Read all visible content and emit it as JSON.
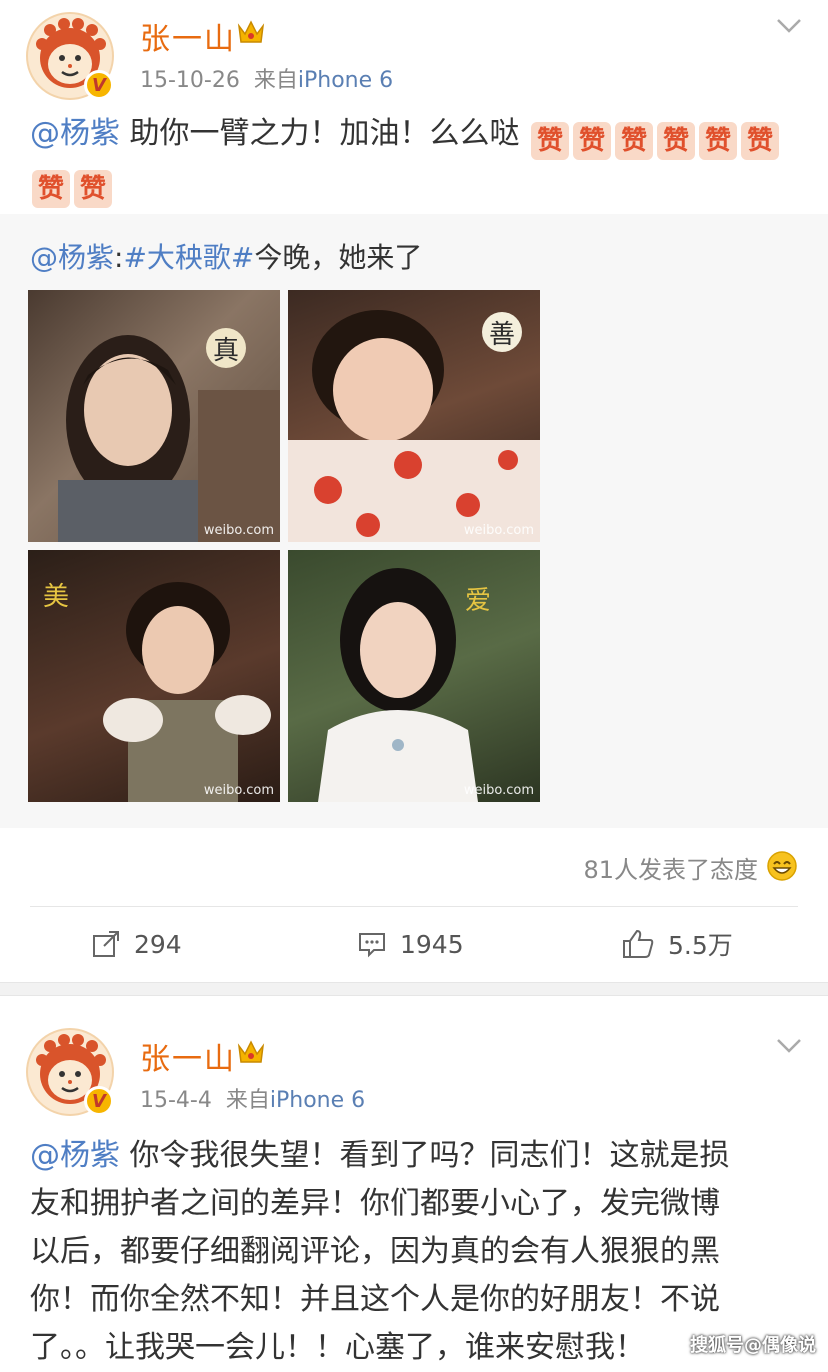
{
  "post1": {
    "author": "张一山",
    "date": "15-10-26",
    "source_prefix": "来自",
    "source": "iPhone 6",
    "mention": "@杨紫",
    "text": " 助你一臂之力！加油！么么哒",
    "zan_char": "赞",
    "zan_count": 8,
    "repost": {
      "mention": "@杨紫",
      "colon": ":",
      "hashtag": "#大秧歌#",
      "text": "今晚，她来了",
      "photos": [
        {
          "char": "真",
          "watermark": "weibo.com"
        },
        {
          "char": "善",
          "watermark": "weibo.com"
        },
        {
          "char": "美",
          "watermark": "weibo.com"
        },
        {
          "char": "爱",
          "watermark": "weibo.com"
        }
      ]
    },
    "attitude": "81人发表了态度",
    "reposts": "294",
    "comments": "1945",
    "likes": "5.5万"
  },
  "post2": {
    "author": "张一山",
    "date": "15-4-4",
    "source_prefix": "来自",
    "source": "iPhone 6",
    "mention": "@杨紫",
    "lines": [
      " 你令我很失望！看到了吗？同志们！这就是损",
      "友和拥护者之间的差异！你们都要小心了，发完微博",
      "以后，都要仔细翻阅评论，因为真的会有人狠狠的黑",
      "你！而你全然不知！并且这个人是你的好朋友！不说",
      "了。。让我哭一会儿！！心塞了，谁来安慰我！"
    ]
  },
  "watermark": "搜狐号@偶像说",
  "colors": {
    "name": "#e86b10",
    "link": "#4f7ec4",
    "gray": "#888888"
  }
}
